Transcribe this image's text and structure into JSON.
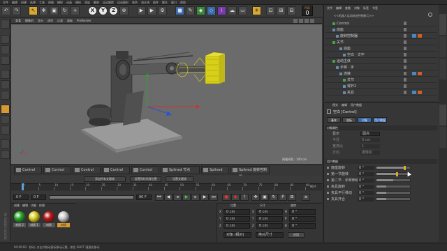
{
  "menubar": [
    "文件",
    "编辑",
    "创建",
    "选择",
    "工具",
    "网格",
    "捕捉",
    "动画",
    "模拟",
    "渲染",
    "雕刻",
    "运动跟踪",
    "运动图形",
    "角色",
    "流水线",
    "插件",
    "脚本",
    "窗口",
    "帮助"
  ],
  "toolbar": {
    "axis_x": "X",
    "axis_y": "Y",
    "axis_z": "Z",
    "badge_value": "0"
  },
  "viewport": {
    "menu": [
      "查看",
      "摄像机",
      "显示",
      "选项",
      "过滤",
      "面板",
      "ProRender"
    ],
    "scale_label": "网格间距 : 100 cm"
  },
  "object_manager": {
    "menu": [
      "文件",
      "编辑",
      "查看",
      "对象",
      "标签",
      "书签"
    ],
    "breadcrumb": "<<机器人运动轨迹控制练习>>",
    "rows": [
      {
        "label": "Control",
        "indent": 2
      },
      {
        "label": "底座",
        "indent": 2
      },
      {
        "label": "旋转控制器",
        "indent": 3
      },
      {
        "label": "关节",
        "indent": 2
      },
      {
        "label": "底座",
        "indent": 4
      },
      {
        "label": "空白 · 文字",
        "indent": 5
      },
      {
        "label": "运动主体",
        "indent": 2
      },
      {
        "label": "手臂 · 手",
        "indent": 3
      },
      {
        "label": "连接",
        "indent": 4
      },
      {
        "label": "关节",
        "indent": 5
      },
      {
        "label": "臂杆2",
        "indent": 5
      },
      {
        "label": "夹具",
        "indent": 5
      }
    ]
  },
  "attribute_manager": {
    "menu": [
      "模式",
      "编辑",
      "用户数据"
    ],
    "object_title": "空白 [Control]",
    "tabs": [
      "基本",
      "坐标",
      "对象",
      "用户数据"
    ],
    "section_object": "对象属性",
    "display_label": "显示",
    "display_value": "圆点",
    "radius_label": "半径",
    "radius_value": "0 cm",
    "aspect_label": "宽高比",
    "aspect_value": "1",
    "orient_label": "方向",
    "orient_value": "摄像机",
    "section_user": "用户数据",
    "user_rows": [
      {
        "label": "底座旋转",
        "value": "0 °",
        "fill": 0.85
      },
      {
        "label": "第一节旋转",
        "value": "0 °",
        "fill": 0.6
      },
      {
        "label": "第二节 · 手臂伸缩",
        "value": "0 °",
        "fill": 0.5
      },
      {
        "label": "夹具旋转",
        "value": "0 °",
        "fill": 0.3
      },
      {
        "label": "夹具平行移动",
        "value": "0 °",
        "fill": 0.3
      },
      {
        "label": "夹具开合",
        "value": "0 °",
        "fill": 0.3
      }
    ]
  },
  "tracks": [
    {
      "label": "Control"
    },
    {
      "label": "Control"
    },
    {
      "label": "Control"
    },
    {
      "label": "Control"
    },
    {
      "label": "Control"
    },
    {
      "label": "Splined 节点"
    },
    {
      "label": "Splined"
    },
    {
      "label": "Splined 旋转控制器"
    }
  ],
  "timeline": {
    "ticks": [
      "0",
      "5",
      "10",
      "15",
      "20",
      "25",
      "30",
      "35",
      "40",
      "45",
      "50",
      "55",
      "60",
      "65",
      "70",
      "75",
      "80",
      "85",
      "90"
    ],
    "frame_current": "0 F",
    "frame_start": "0 F",
    "frame_end": "90 F",
    "frame_max": "90 F",
    "buttons": [
      "添加所有关键帧",
      "设置到时间线位置",
      "设置关键帧"
    ]
  },
  "materials": {
    "menu": [
      "创建",
      "编辑",
      "功能",
      "纹理"
    ],
    "items": [
      {
        "label": "材质 2",
        "color": "#2aa82a"
      },
      {
        "label": "材质 1",
        "color": "#e0d020"
      },
      {
        "label": "材质",
        "color": "#c01818"
      },
      {
        "label": "材质",
        "color": "#cccccc"
      }
    ]
  },
  "coordinates": {
    "headers": [
      "位置",
      "尺寸",
      "旋转"
    ],
    "rows": [
      {
        "axis": "X",
        "pos": "0 cm",
        "size": "0 cm",
        "rot_axis": "H",
        "rot": "0 °"
      },
      {
        "axis": "Y",
        "pos": "0 cm",
        "size": "0 cm",
        "rot_axis": "P",
        "rot": "0 °"
      },
      {
        "axis": "Z",
        "pos": "0 cm",
        "size": "0 cm",
        "rot_axis": "B",
        "rot": "0 °"
      }
    ],
    "mode_select": "对象 (相对)",
    "size_select": "绝对尺寸",
    "apply": "应用"
  },
  "status_bar": "00:00:00 · 移动: 点击并拖动鼠标移动元素。按住 SHIFT 键量化移动",
  "brand": "MAXON CINEMA 4D",
  "colors": {
    "accent": "#d89a30",
    "viewport_bg": "#6b6b6b",
    "selection_yellow": "#e8e020"
  }
}
